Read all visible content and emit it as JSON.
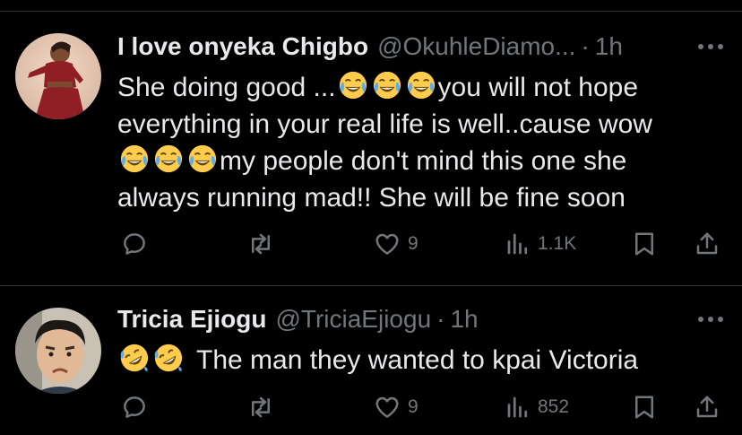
{
  "tweets": [
    {
      "name": "I love onyeka Chigbo",
      "handle": "@OkuhleDiamo...",
      "separator": "·",
      "time": "1h",
      "body_line1_a": "She doing good ...",
      "body_line1_b": "you will not hope",
      "body_line2": "everything in your real life is well..cause wow",
      "body_line3": "my people don't mind this one she",
      "body_line4": "always running mad!! She will be fine soon",
      "emoji_name": "joy-emoji",
      "likes": "9",
      "views": "1.1K"
    },
    {
      "name": "Tricia Ejiogu",
      "handle": "@TriciaEjiogu",
      "separator": "·",
      "time": "1h",
      "body_text": "The man they wanted to kpai Victoria",
      "emoji_name": "rofl-emoji",
      "likes": "9",
      "views": "852"
    }
  ],
  "colors": {
    "background": "#000000",
    "text": "#e7e9ea",
    "muted": "#71767b",
    "divider": "#2f3336"
  },
  "icons": [
    "reply-icon",
    "retweet-icon",
    "like-icon",
    "views-icon",
    "bookmark-icon",
    "share-icon",
    "more-icon"
  ]
}
